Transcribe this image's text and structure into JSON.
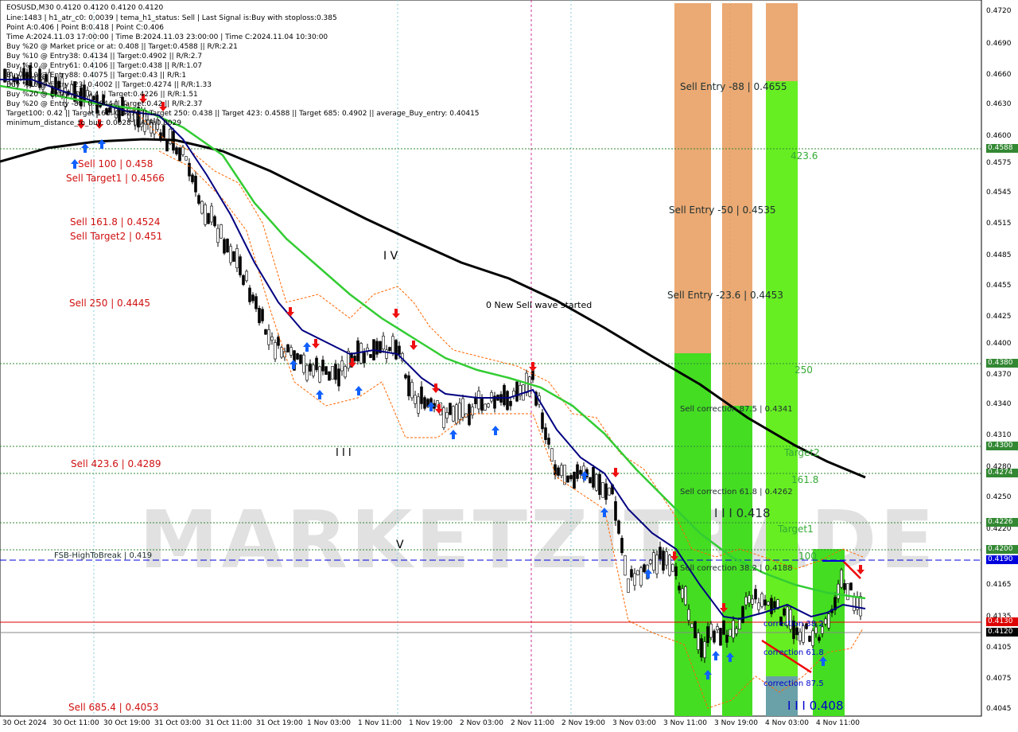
{
  "info": {
    "line1": "EOSUSD,M30  0.4120 0.4120 0.4120 0.4120",
    "line2": "Line:1483 | h1_atr_c0: 0.0039 | tema_h1_status: Sell | Last Signal is:Buy with stoploss:0.385",
    "line3": "Point A:0.406 | Point B:0.418 | Point C:0.406",
    "line4": "Time A:2024.11.03 17:00:00 | Time B:2024.11.03 23:00:00 | Time C:2024.11.04 10:30:00",
    "line5": "Buy %20 @ Market price or at: 0.408 || Target:0.4588 || R/R:2.21",
    "line6": "Buy %10 @ Entry38: 0.4134 || Target:0.4902 || R/R:2.7",
    "line7": "Buy %10 @ Entry61: 0.4106 || Target:0.438 || R/R:1.07",
    "line8": "Buy %10 @ Entry88: 0.4075 || Target:0.43 || R/R:1",
    "line9": "Buy %10 @ Entry -23: 0.4002 || Target:0.4274 || R/R:1.33",
    "line10": "Buy %20 @ Entry -50: 0.4 || Target:0.4226 || R/R:1.51",
    "line11": "Buy %20 @ Entry -88: 0.3944 || Target:0.42 || R/R:2.37",
    "line12": "Target100: 0.42 || Target 161: 0.4274 || Target 250: 0.438 || Target 423: 0.4588 || Target 685: 0.4902 || average_Buy_entry: 0.40415",
    "line13": "minimum_distance_to_buy: 0.0028 || ATR:0.0029"
  },
  "left_labels": {
    "sell100": "Sell 100 | 0.458",
    "sellTarget1": "Sell Target1 | 0.4566",
    "sell161": "Sell 161.8 | 0.4524",
    "sellTarget2": "Sell Target2 | 0.451",
    "sell250": "Sell 250 | 0.4445",
    "sell423": "Sell 423.6 | 0.4289",
    "fsb": "FSB-HighToBreak | 0.419",
    "sell685": "Sell 685.4 | 0.4053"
  },
  "mid_labels": {
    "wave_iv": "I V",
    "wave_v": "V",
    "wave_iii": "I I I",
    "new_sell_wave": "0 New Sell wave started"
  },
  "zone_labels": {
    "sell_entry_88": "Sell Entry -88 | 0.4655",
    "sell_entry_50": "Sell Entry -50 | 0.4535",
    "sell_entry_23": "Sell Entry -23.6 | 0.4453",
    "sell_corr_87": "Sell correction 87.5 | 0.4341",
    "sell_corr_61": "Sell correction 61.8 | 0.4262",
    "sell_corr_38": "Sell correction 38.2 | 0.4188",
    "iii_0418": "I I I 0.418",
    "iii_0408": "I I I 0.408",
    "l423": "423.6",
    "l250": "250",
    "target2": "Target2",
    "l161": "161.8",
    "target1": "Target1",
    "l100": "100",
    "corr38": "correction 38.2",
    "corr61": "correction 61.8",
    "corr87": "correction 87.5"
  },
  "watermark": "MARKETZITRADE",
  "price_axis": [
    "0.4720",
    "0.4690",
    "0.4660",
    "0.4630",
    "0.4600",
    "0.4575",
    "0.4545",
    "0.4515",
    "0.4485",
    "0.4455",
    "0.4425",
    "0.4400",
    "0.4370",
    "0.4340",
    "0.4310",
    "0.4280",
    "0.4250",
    "0.4220",
    "0.4190",
    "0.4165",
    "0.4135",
    "0.4105",
    "0.4075",
    "0.4045"
  ],
  "price_tags": {
    "t4588": "0.4588",
    "t4380": "0.4380",
    "t4300": "0.4300",
    "t4274": "0.4274",
    "t4226": "0.4226",
    "t4200": "0.4200",
    "t4190": "0.4190",
    "t4130": "0.4130",
    "t4120": "0.4120"
  },
  "time_axis": [
    "30 Oct 2024",
    "30 Oct 11:00",
    "30 Oct 19:00",
    "31 Oct 03:00",
    "31 Oct 11:00",
    "31 Oct 19:00",
    "1 Nov 03:00",
    "1 Nov 11:00",
    "1 Nov 19:00",
    "2 Nov 03:00",
    "2 Nov 11:00",
    "2 Nov 19:00",
    "3 Nov 03:00",
    "3 Nov 11:00",
    "3 Nov 19:00",
    "4 Nov 03:00",
    "4 Nov 11:00"
  ],
  "colors": {
    "bg": "#ffffff",
    "candle": "#000000",
    "ma_fast": "#000080",
    "ma_mid": "#33cc33",
    "ma_slow": "#000000",
    "orange_zone": "#e8a060",
    "green_zone": "#44dd22",
    "level_green": "#338833",
    "level_red": "#dd0000",
    "level_blue": "#0000dd"
  }
}
